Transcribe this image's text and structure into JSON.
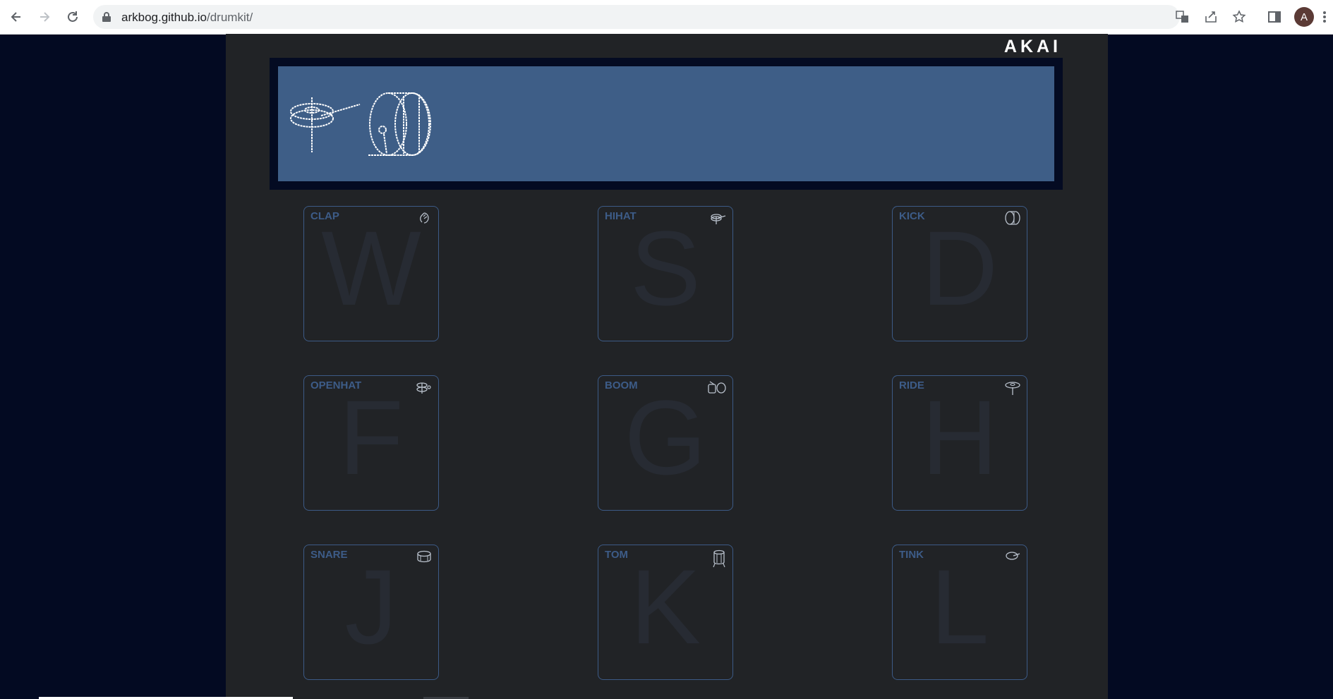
{
  "browser": {
    "url_host": "arkbog.github.io",
    "url_path": "/drumkit/",
    "avatar_letter": "A",
    "icons": [
      "back-arrow-icon",
      "forward-arrow-icon",
      "reload-icon",
      "lock-icon",
      "translate-icon",
      "share-icon",
      "star-icon",
      "sidepanel-icon",
      "menu-dots-icon"
    ]
  },
  "page": {
    "brand": "AKAI",
    "display_icons": [
      "hihat-drawing-icon",
      "kick-drum-drawing-icon"
    ],
    "pads": [
      {
        "name": "CLAP",
        "key": "W",
        "icon": "clap-hands-icon"
      },
      {
        "name": "HIHAT",
        "key": "S",
        "icon": "hihat-icon"
      },
      {
        "name": "KICK",
        "key": "D",
        "icon": "kick-drum-icon"
      },
      {
        "name": "OPENHAT",
        "key": "F",
        "icon": "openhat-icon"
      },
      {
        "name": "BOOM",
        "key": "G",
        "icon": "boom-drums-icon"
      },
      {
        "name": "RIDE",
        "key": "H",
        "icon": "ride-cymbal-icon"
      },
      {
        "name": "SNARE",
        "key": "J",
        "icon": "snare-drum-icon"
      },
      {
        "name": "TOM",
        "key": "K",
        "icon": "tom-drum-icon"
      },
      {
        "name": "TINK",
        "key": "L",
        "icon": "tink-icon"
      }
    ]
  },
  "colors": {
    "background": "#030a22",
    "device": "#212326",
    "display": "#3e5e87",
    "pad_border": "#3c5a86",
    "pad_label": "#3d5c88",
    "pad_key": "#272b33"
  }
}
